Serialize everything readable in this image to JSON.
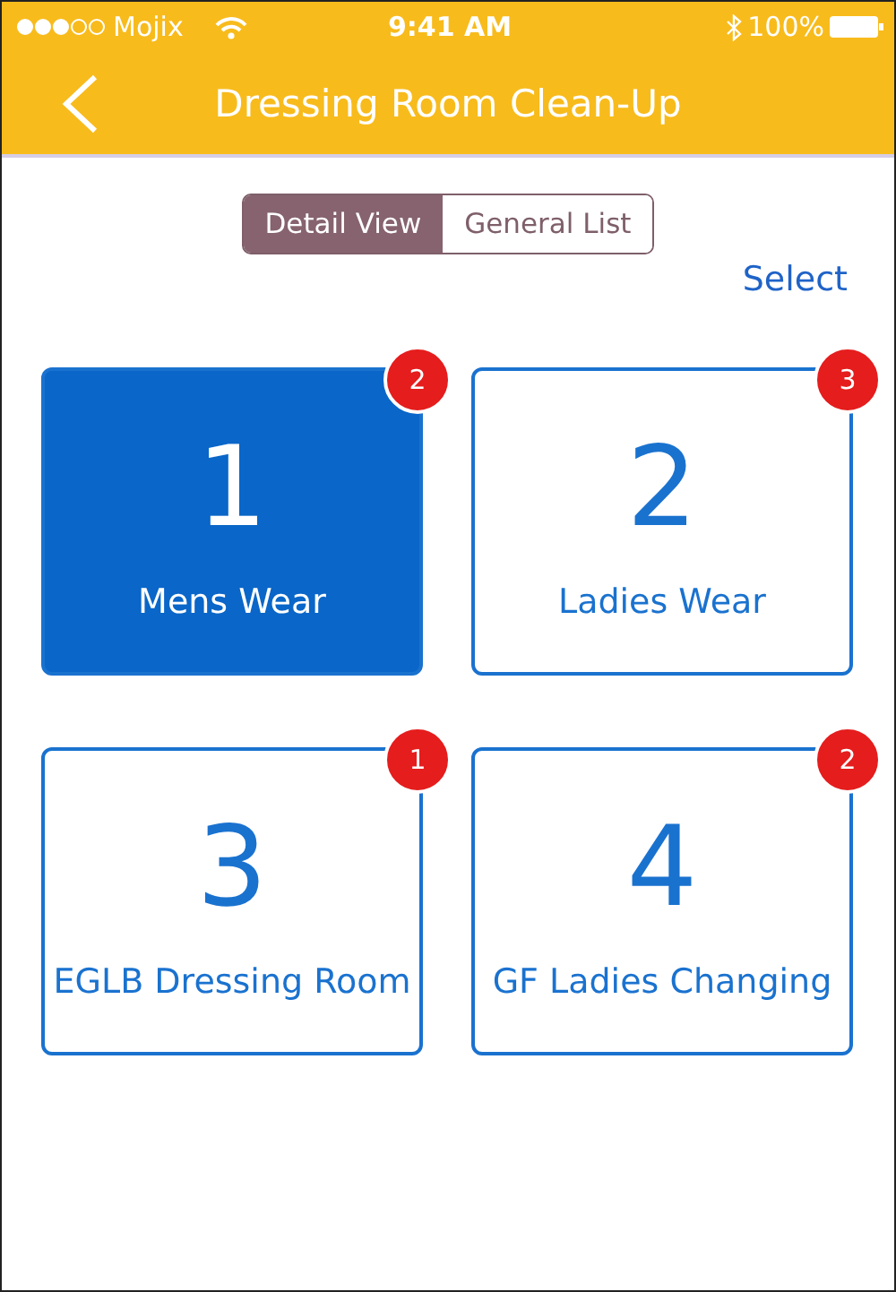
{
  "status_bar": {
    "carrier": "Mojix",
    "time": "9:41 AM",
    "battery": "100%"
  },
  "header": {
    "title": "Dressing Room Clean-Up"
  },
  "segments": [
    {
      "label": "Detail View",
      "selected": true
    },
    {
      "label": "General List",
      "selected": false
    }
  ],
  "select_link": "Select",
  "tiles": [
    {
      "number": "1",
      "label": "Mens Wear",
      "badge": "2",
      "selected": true
    },
    {
      "number": "2",
      "label": "Ladies Wear",
      "badge": "3",
      "selected": false
    },
    {
      "number": "3",
      "label": "EGLB Dressing Room",
      "badge": "1",
      "selected": false
    },
    {
      "number": "4",
      "label": "GF Ladies Changing",
      "badge": "2",
      "selected": false
    }
  ]
}
